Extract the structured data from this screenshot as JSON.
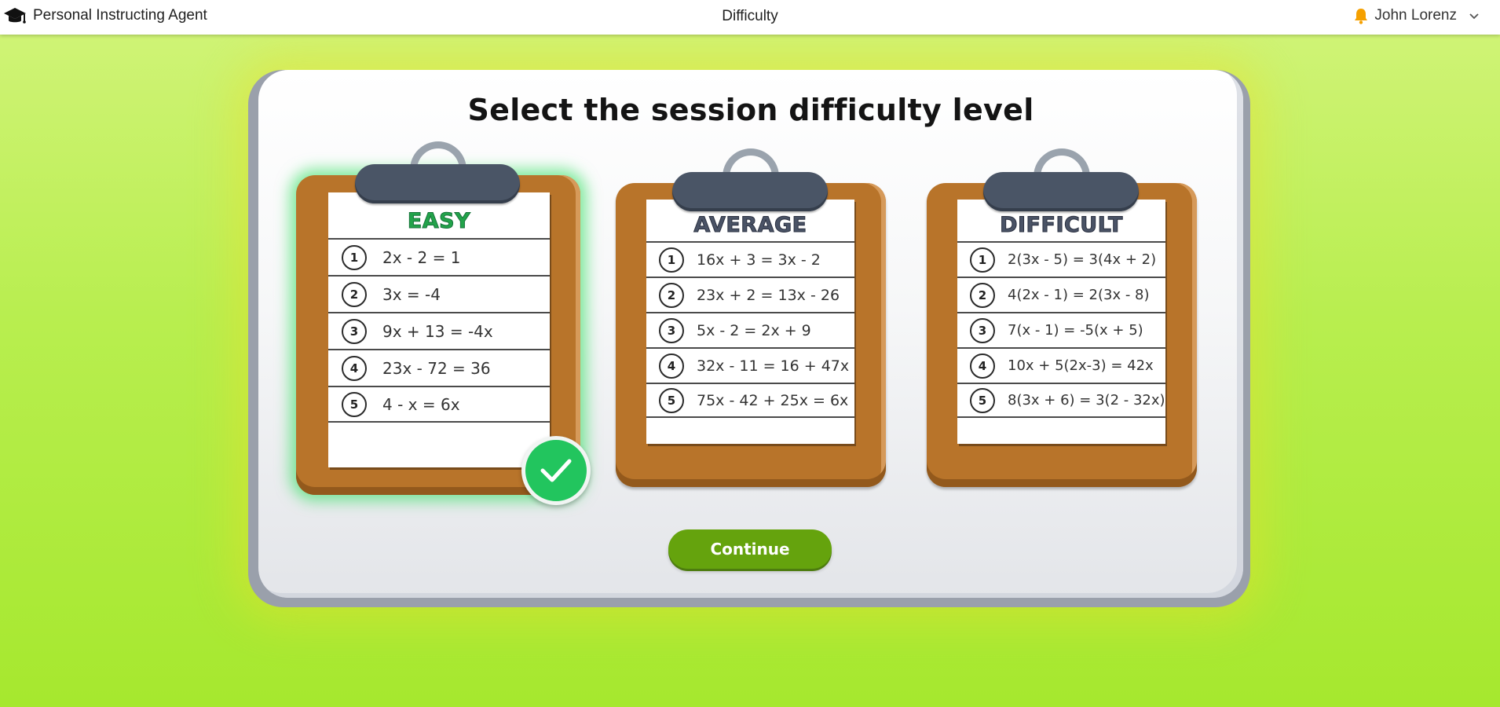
{
  "app": {
    "name": "Personal Instructing Agent",
    "icon": "graduation-cap-icon"
  },
  "header": {
    "title": "Difficulty"
  },
  "user": {
    "name": "John Lorenz",
    "notification_icon": "bell-icon",
    "menu_icon": "chevron-down-icon"
  },
  "main": {
    "heading": "Select the session difficulty level",
    "levels": [
      {
        "label": "EASY",
        "selected": true,
        "problems": [
          {
            "n": "1",
            "eq": "2x - 2 = 1"
          },
          {
            "n": "2",
            "eq": "3x = -4"
          },
          {
            "n": "3",
            "eq": "9x + 13 = -4x"
          },
          {
            "n": "4",
            "eq": "23x - 72 = 36"
          },
          {
            "n": "5",
            "eq": "4 - x = 6x"
          }
        ]
      },
      {
        "label": "AVERAGE",
        "selected": false,
        "problems": [
          {
            "n": "1",
            "eq": "16x + 3 = 3x - 2"
          },
          {
            "n": "2",
            "eq": "23x + 2 = 13x - 26"
          },
          {
            "n": "3",
            "eq": "5x - 2 = 2x + 9"
          },
          {
            "n": "4",
            "eq": "32x - 11 = 16 + 47x"
          },
          {
            "n": "5",
            "eq": "75x - 42 + 25x = 6x"
          }
        ]
      },
      {
        "label": "DIFFICULT",
        "selected": false,
        "problems": [
          {
            "n": "1",
            "eq": "2(3x - 5) = 3(4x + 2)"
          },
          {
            "n": "2",
            "eq": "4(2x - 1) = 2(3x - 8)"
          },
          {
            "n": "3",
            "eq": "7(x - 1) = -5(x + 5)"
          },
          {
            "n": "4",
            "eq": "10x + 5(2x-3) = 42x"
          },
          {
            "n": "5",
            "eq": "8(3x + 6) = 3(2 - 32x)"
          }
        ]
      }
    ],
    "continue_label": "Continue"
  },
  "colors": {
    "accent": "#65a30d",
    "selected_check": "#22c55e",
    "easy_title": "#22a34a",
    "clipboard": "#b8742a",
    "clip": "#4a5566"
  }
}
